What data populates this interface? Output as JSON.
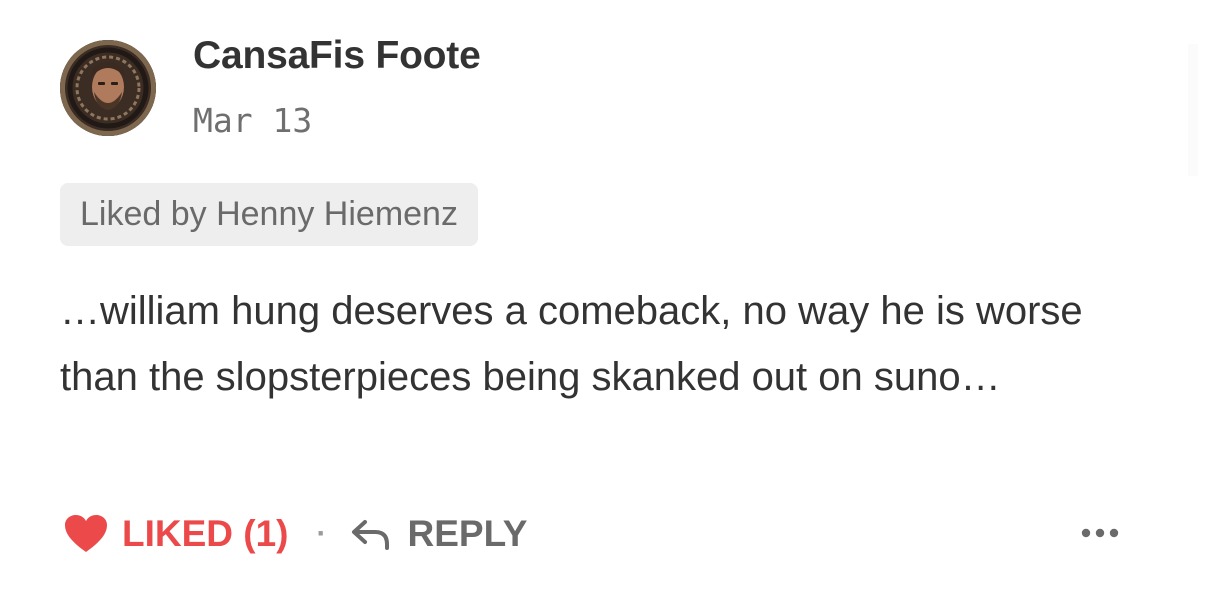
{
  "comment": {
    "author_name": "CansaFis Foote",
    "date": "Mar 13",
    "liked_by": "Liked by Henny Hiemenz",
    "body": "…william hung deserves a comeback, no way he is worse than the slopsterpieces being skanked out on suno…"
  },
  "actions": {
    "like_label": "LIKED (1)",
    "separator": "·",
    "reply_label": "REPLY",
    "more_icon": "ellipsis-icon",
    "heart_icon": "heart-icon",
    "reply_icon": "reply-arrow-icon"
  },
  "colors": {
    "liked": "#ec4a4a",
    "text": "#333333",
    "muted": "#6a6a6a",
    "chip_bg": "#eeeeee"
  }
}
